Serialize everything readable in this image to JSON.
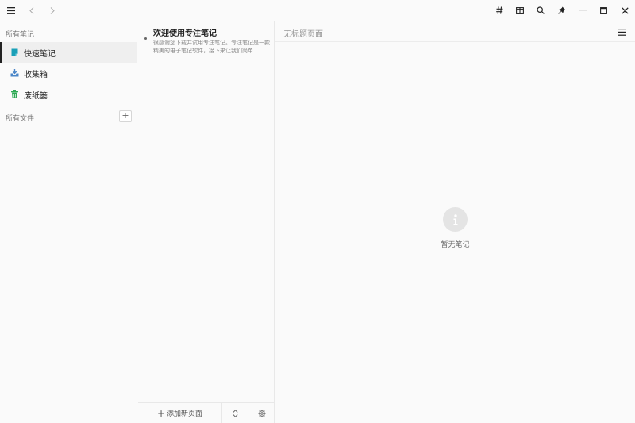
{
  "toolbar": {
    "menu_icon": "hamburger-icon",
    "back_icon": "chevron-left-icon",
    "forward_icon": "chevron-right-icon",
    "right_icons": [
      "hash-icon",
      "split-view-icon",
      "search-icon",
      "pin-icon",
      "minimize-icon",
      "maximize-icon",
      "close-icon"
    ]
  },
  "sidebar": {
    "notes_section": "所有笔记",
    "items": [
      {
        "label": "快速笔记",
        "icon": "note-icon",
        "color": "#1aa0b8",
        "active": true
      },
      {
        "label": "收集箱",
        "icon": "inbox-icon",
        "color": "#4a86c8",
        "active": false
      },
      {
        "label": "废纸篓",
        "icon": "trash-icon",
        "color": "#2eaa55",
        "active": false
      }
    ],
    "files_section": "所有文件",
    "add_folder": "+"
  },
  "notelist": {
    "notes": [
      {
        "title": "欢迎使用专注笔记",
        "snippet": "很感谢您下载并试用专注笔记。专注笔记是一款精美的电子笔记软件，接下来让我们简单..."
      }
    ],
    "footer": {
      "add_page": "添加新页面",
      "add_icon": "plus-icon",
      "sort_icon": "sort-icon",
      "settings_icon": "gear-icon"
    }
  },
  "editor": {
    "title_placeholder": "无标题页面",
    "menu_icon": "hamburger-icon",
    "empty_text": "暂无笔记",
    "empty_icon": "info-icon"
  }
}
